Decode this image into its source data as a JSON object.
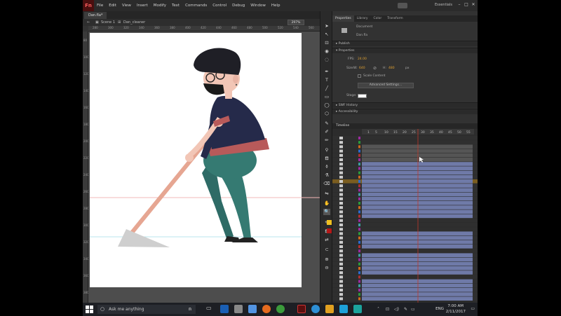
{
  "app": {
    "logo": "Fn",
    "menu": [
      "File",
      "Edit",
      "View",
      "Insert",
      "Modify",
      "Text",
      "Commands",
      "Control",
      "Debug",
      "Window",
      "Help"
    ],
    "workspace": "Essentials"
  },
  "document": {
    "tab": "Dan.fla*",
    "scene": "Scene 1",
    "symbol": "Dan_cleaner",
    "zoom": "297%"
  },
  "ruler": {
    "top_ticks": [
      "280",
      "300",
      "320",
      "340",
      "360",
      "380",
      "400",
      "420",
      "440",
      "460",
      "480",
      "500",
      "520",
      "540",
      "560"
    ],
    "left_ticks": [
      "80",
      "100",
      "120",
      "140",
      "160",
      "180",
      "200",
      "220",
      "240",
      "260",
      "280",
      "300",
      "320",
      "340",
      "360",
      "380"
    ]
  },
  "properties": {
    "tabs": [
      "Properties",
      "Library",
      "Color",
      "Transform"
    ],
    "doc_type": "Document",
    "doc_name": "Dan.fla",
    "publish_label": "Publish",
    "properties_label": "Properties",
    "fps_label": "FPS:",
    "fps_value": "24.00",
    "size_label": "Size:",
    "w_label": "W:",
    "w_value": "640",
    "h_label": "H:",
    "h_value": "480",
    "units": "px",
    "scale_content": "Scale Content",
    "advanced": "Advanced Settings...",
    "stage_label": "Stage:",
    "swf_history": "SWF History",
    "accessibility": "Accessibility"
  },
  "timeline": {
    "title": "Timeline",
    "frames": [
      "1",
      "5",
      "10",
      "15",
      "20",
      "25",
      "30",
      "35",
      "40",
      "45",
      "50",
      "55"
    ]
  },
  "taskbar": {
    "search": "Ask me anything",
    "lang": "ENG",
    "time": "7:00 AM",
    "date": "2/11/2017"
  },
  "colors": {
    "app_bg": "#323232",
    "accent": "#e0a030",
    "frames": "#6f7aa8",
    "playhead": "#c0392b"
  }
}
